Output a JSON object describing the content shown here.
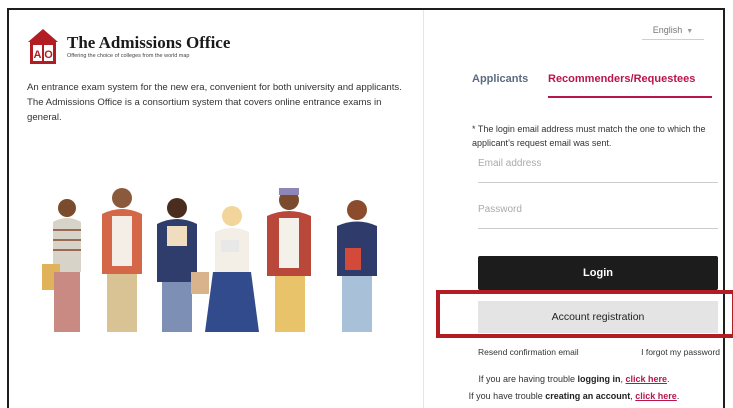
{
  "brand": {
    "logo_letters": "AO",
    "title": "The Admissions Office",
    "subtitle": "Offering the choice of colleges from the world map",
    "description": "An entrance exam system for the new era, convenient for both university and applicants. The Admissions Office is a consortium system that covers online entrance exams in general."
  },
  "language": {
    "selected": "English"
  },
  "tabs": [
    {
      "label": "Applicants",
      "active": false
    },
    {
      "label": "Recommenders/Requestees",
      "active": true
    }
  ],
  "form": {
    "note": "* The login email address must match the one to which the applicant’s request email was sent.",
    "email_placeholder": "Email address",
    "password_placeholder": "Password",
    "login_label": "Login",
    "register_label": "Account registration",
    "resend_label": "Resend confirmation email",
    "forgot_label": "I forgot my password"
  },
  "help": {
    "login_prefix": "If you are having trouble ",
    "login_bold": "logging in",
    "login_sep": ", ",
    "login_link": "click here",
    "login_end": ".",
    "account_prefix": "If you have trouble ",
    "account_bold": "creating an account",
    "account_sep": ", ",
    "account_link": "click here",
    "account_end": "."
  },
  "colors": {
    "accent": "#b8154b",
    "highlight_box": "#b21d24",
    "login_button": "#1c1c1c",
    "register_button": "#e4e4e4"
  }
}
